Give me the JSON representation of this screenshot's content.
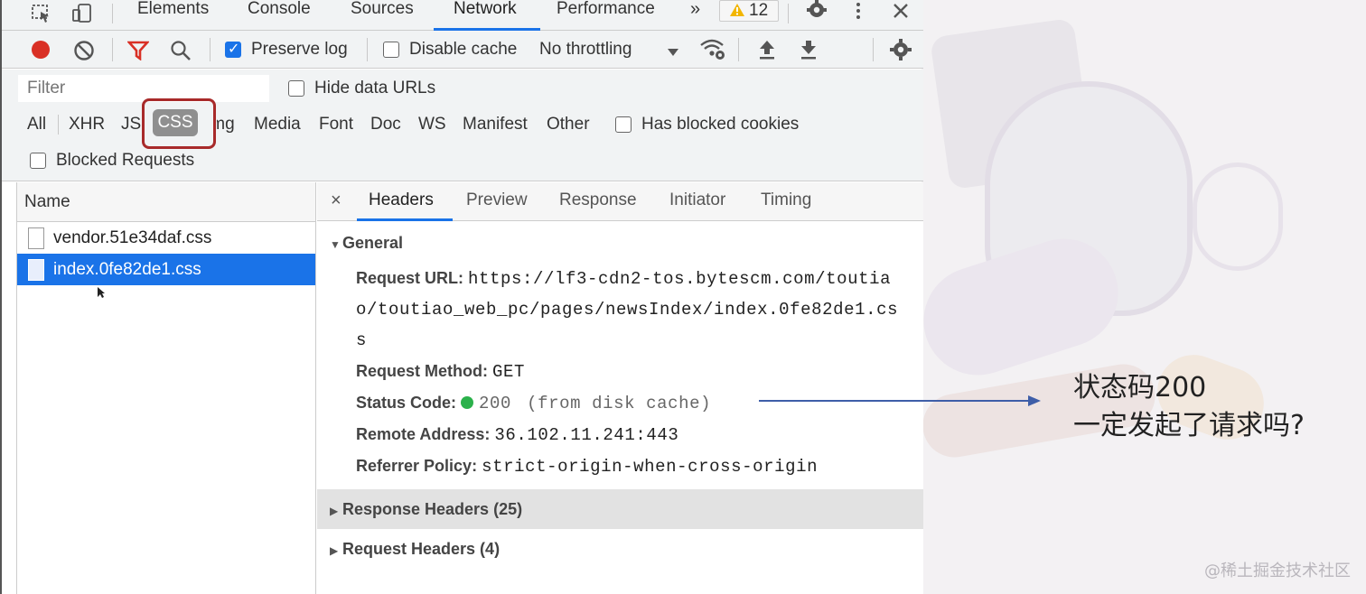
{
  "devtools": {
    "tabs": [
      "Elements",
      "Console",
      "Sources",
      "Network",
      "Performance"
    ],
    "active_tab": "Network",
    "more_symbol": "»",
    "warning_count": "12",
    "toolbar": {
      "preserve_log_label": "Preserve log",
      "preserve_log_checked": true,
      "disable_cache_label": "Disable cache",
      "disable_cache_checked": false,
      "throttling": "No throttling"
    },
    "filter": {
      "placeholder": "Filter",
      "hide_data_urls_label": "Hide data URLs",
      "types": [
        "All",
        "XHR",
        "JS",
        "CSS",
        "Img",
        "Media",
        "Font",
        "Doc",
        "WS",
        "Manifest",
        "Other"
      ],
      "selected_type": "CSS",
      "has_blocked_cookies_label": "Has blocked cookies",
      "blocked_requests_label": "Blocked Requests"
    },
    "requests": {
      "header": "Name",
      "items": [
        {
          "name": "vendor.51e34daf.css",
          "selected": false
        },
        {
          "name": "index.0fe82de1.css",
          "selected": true
        }
      ]
    },
    "details": {
      "close_symbol": "×",
      "tabs": [
        "Headers",
        "Preview",
        "Response",
        "Initiator",
        "Timing"
      ],
      "active_tab": "Headers",
      "general": {
        "title": "General",
        "request_url_label": "Request URL:",
        "request_url_line1": "https://lf3-cdn2-tos.bytescm.com/toutia",
        "request_url_line2": "o/toutiao_web_pc/pages/newsIndex/index.0fe82de1.cs",
        "request_url_line3": "s",
        "request_method_label": "Request Method:",
        "request_method": "GET",
        "status_code_label": "Status Code:",
        "status_code": "200",
        "status_note": "(from disk cache)",
        "status_color": "#2bb14b",
        "remote_address_label": "Remote Address:",
        "remote_address": "36.102.11.241:443",
        "referrer_policy_label": "Referrer Policy:",
        "referrer_policy": "strict-origin-when-cross-origin"
      },
      "response_headers": "Response Headers (25)",
      "request_headers": "Request Headers (4)"
    }
  },
  "annotation": {
    "line1": "状态码200",
    "line2": "一定发起了请求吗?",
    "watermark": "@稀土掘金技术社区"
  }
}
